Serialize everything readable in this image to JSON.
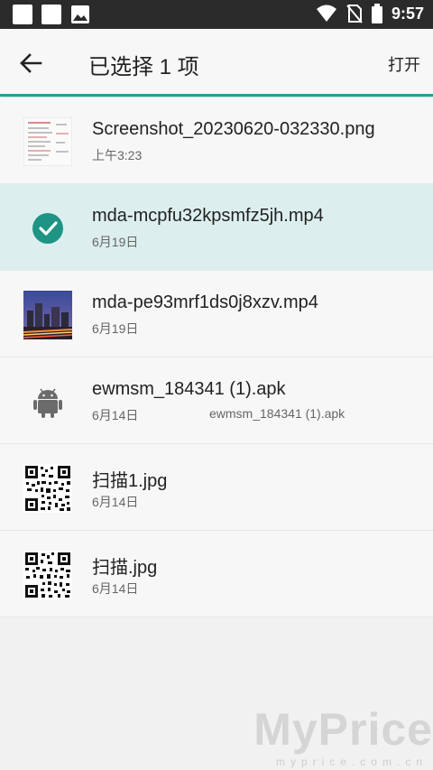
{
  "status_bar": {
    "time": "9:57",
    "icons_left": [
      "square-icon",
      "square-icon",
      "image-icon"
    ],
    "icons_right": [
      "wifi-icon",
      "no-sim-icon",
      "battery-icon"
    ]
  },
  "toolbar": {
    "title": "已选择 1 项",
    "open_label": "打开",
    "accent_color": "#2a9d8f"
  },
  "files": [
    {
      "name": "Screenshot_20230620-032330.png",
      "date": "上午3:23",
      "extra": "",
      "thumb": "screenshot-thumbnail",
      "selected": false
    },
    {
      "name": "mda-mcpfu32kpsmfz5jh.mp4",
      "date": "6月19日",
      "extra": "",
      "thumb": "check-circle-icon",
      "selected": true
    },
    {
      "name": "mda-pe93mrf1ds0j8xzv.mp4",
      "date": "6月19日",
      "extra": "",
      "thumb": "city-night-thumbnail",
      "selected": false
    },
    {
      "name": "ewmsm_184341 (1).apk",
      "date": "6月14日",
      "extra": "ewmsm_184341 (1).apk",
      "thumb": "android-icon",
      "selected": false
    },
    {
      "name": "扫描1.jpg",
      "date": "6月14日",
      "extra": "",
      "thumb": "qr-code-thumbnail",
      "selected": false
    },
    {
      "name": "扫描.jpg",
      "date": "6月14日",
      "extra": "",
      "thumb": "qr-code-thumbnail",
      "selected": false
    }
  ],
  "watermark": {
    "text": "MyPrice",
    "sub": "myprice.com.cn"
  }
}
